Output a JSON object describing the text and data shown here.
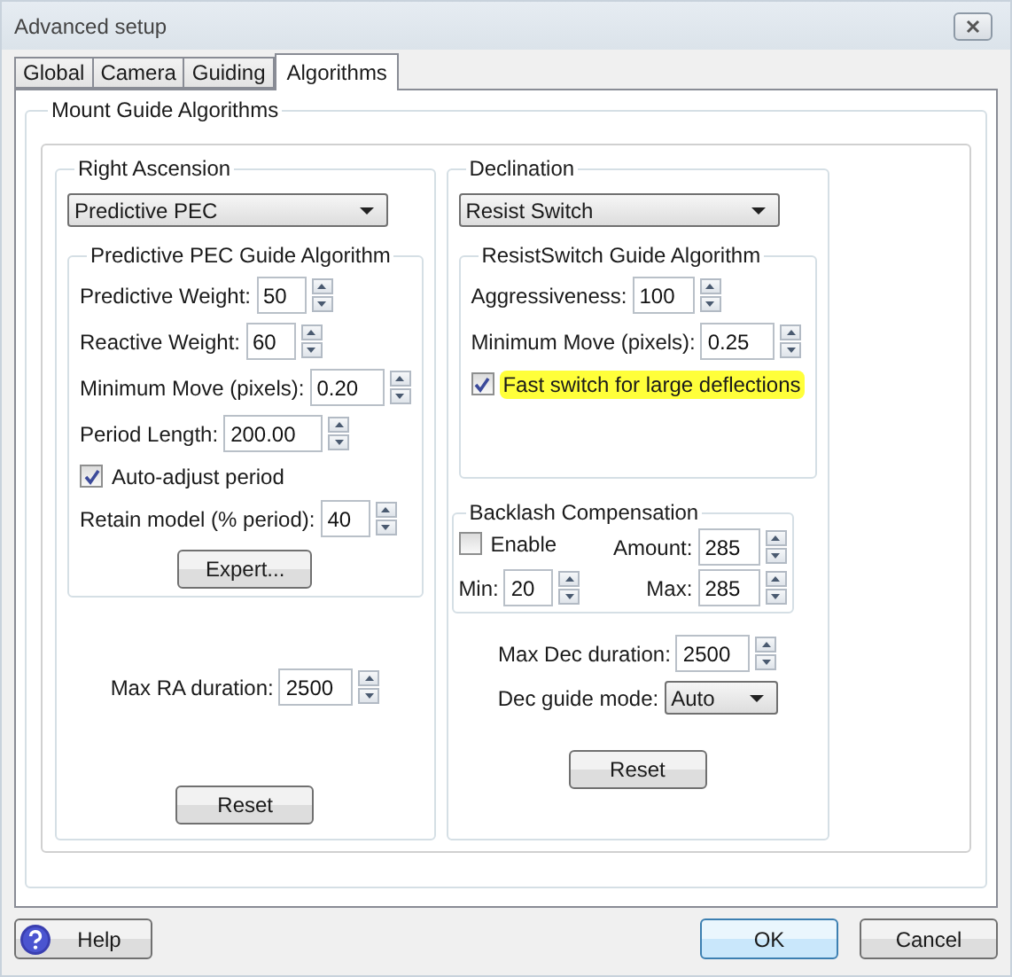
{
  "window": {
    "title": "Advanced setup"
  },
  "tabs": [
    {
      "label": "Global",
      "selected": false
    },
    {
      "label": "Camera",
      "selected": false
    },
    {
      "label": "Guiding",
      "selected": false
    },
    {
      "label": "Algorithms",
      "selected": true
    }
  ],
  "group_title": "Mount Guide Algorithms",
  "ra": {
    "title": "Right Ascension",
    "algorithm": "Predictive PEC",
    "algo_group": {
      "title": "Predictive PEC Guide Algorithm",
      "rows": [
        {
          "kind": "spin",
          "label": "Predictive Weight:",
          "value": "50"
        },
        {
          "kind": "spin",
          "label": "Reactive Weight:",
          "value": "60"
        },
        {
          "kind": "spin",
          "label": "Minimum Move (pixels):",
          "value": "0.20"
        },
        {
          "kind": "spin",
          "label": "Period Length:",
          "value": "200.00"
        },
        {
          "kind": "checkbox",
          "label": "Auto-adjust period",
          "checked": true,
          "highlighted": false
        },
        {
          "kind": "spin",
          "label": "Retain model (% period):",
          "value": "40"
        },
        {
          "kind": "button",
          "label": "Expert..."
        }
      ]
    },
    "duration": {
      "label": "Max RA duration:",
      "value": "2500"
    },
    "reset": "Reset"
  },
  "dec": {
    "title": "Declination",
    "algorithm": "Resist Switch",
    "algo_group": {
      "title": "ResistSwitch Guide Algorithm",
      "rows": [
        {
          "kind": "spin",
          "label": "Aggressiveness:",
          "value": "100"
        },
        {
          "kind": "spin",
          "label": "Minimum Move (pixels):",
          "value": "0.25"
        },
        {
          "kind": "checkbox",
          "label": "Fast switch for large deflections",
          "checked": true,
          "highlighted": true
        }
      ]
    },
    "backlash": {
      "title": "Backlash Compensation",
      "enable": {
        "label": "Enable",
        "checked": false
      },
      "amount": {
        "label": "Amount:",
        "value": "285"
      },
      "min": {
        "label": "Min:",
        "value": "20"
      },
      "max": {
        "label": "Max:",
        "value": "285"
      }
    },
    "duration": {
      "label": "Max Dec duration:",
      "value": "2500"
    },
    "mode": {
      "label": "Dec guide mode:",
      "value": "Auto"
    },
    "reset": "Reset"
  },
  "footer": {
    "help": "Help",
    "ok": "OK",
    "cancel": "Cancel"
  }
}
